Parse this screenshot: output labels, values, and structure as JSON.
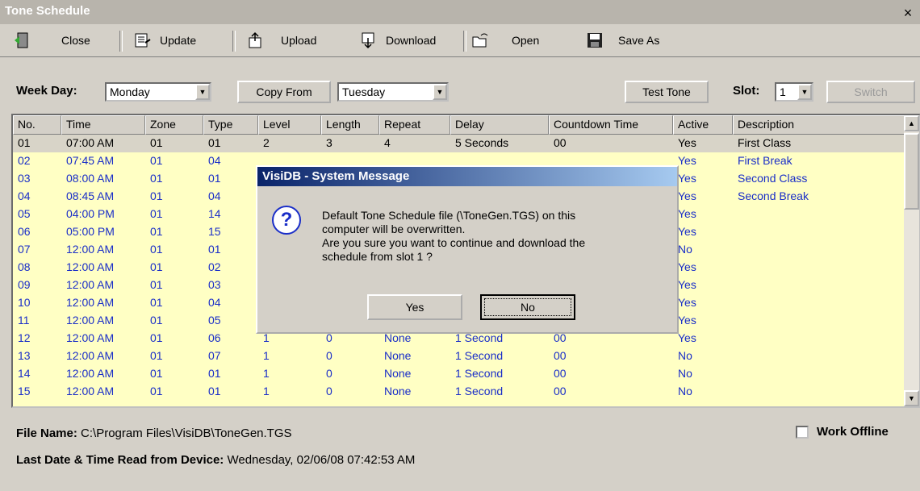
{
  "window": {
    "title": "Tone Schedule",
    "close_glyph": "×"
  },
  "toolbar": {
    "close": "Close",
    "update": "Update",
    "upload": "Upload",
    "download": "Download",
    "open": "Open",
    "save_as": "Save As"
  },
  "filters": {
    "week_day_label": "Week Day:",
    "week_day_value": "Monday",
    "copy_from_label": "Copy From",
    "copy_from_value": "Tuesday",
    "test_tone_label": "Test Tone",
    "slot_label": "Slot:",
    "slot_value": "1",
    "switch_label": "Switch"
  },
  "grid": {
    "headers": [
      "No.",
      "Time",
      "Zone",
      "Type",
      "Level",
      "Length",
      "Repeat",
      "Delay",
      "Countdown Time",
      "Active",
      "Description"
    ],
    "rows": [
      [
        "01",
        "07:00 AM",
        "01",
        "01",
        "2",
        "3",
        "4",
        "5 Seconds",
        "00",
        "Yes",
        "First Class"
      ],
      [
        "02",
        "07:45 AM",
        "01",
        "04",
        "",
        "",
        "",
        "",
        "",
        "Yes",
        "First Break"
      ],
      [
        "03",
        "08:00 AM",
        "01",
        "01",
        "",
        "",
        "",
        "",
        "",
        "Yes",
        "Second Class"
      ],
      [
        "04",
        "08:45 AM",
        "01",
        "04",
        "",
        "",
        "",
        "",
        "",
        "Yes",
        "Second Break"
      ],
      [
        "05",
        "04:00 PM",
        "01",
        "14",
        "",
        "",
        "",
        "",
        "",
        "Yes",
        ""
      ],
      [
        "06",
        "05:00 PM",
        "01",
        "15",
        "",
        "",
        "",
        "",
        "",
        "Yes",
        ""
      ],
      [
        "07",
        "12:00 AM",
        "01",
        "01",
        "",
        "",
        "",
        "",
        "",
        "No",
        ""
      ],
      [
        "08",
        "12:00 AM",
        "01",
        "02",
        "",
        "",
        "",
        "",
        "",
        "Yes",
        ""
      ],
      [
        "09",
        "12:00 AM",
        "01",
        "03",
        "",
        "",
        "",
        "",
        "",
        "Yes",
        ""
      ],
      [
        "10",
        "12:00 AM",
        "01",
        "04",
        "",
        "",
        "",
        "",
        "",
        "Yes",
        ""
      ],
      [
        "11",
        "12:00 AM",
        "01",
        "05",
        "",
        "",
        "",
        "",
        "",
        "Yes",
        ""
      ],
      [
        "12",
        "12:00 AM",
        "01",
        "06",
        "1",
        "0",
        "None",
        "1 Second",
        "00",
        "Yes",
        ""
      ],
      [
        "13",
        "12:00 AM",
        "01",
        "07",
        "1",
        "0",
        "None",
        "1 Second",
        "00",
        "No",
        ""
      ],
      [
        "14",
        "12:00 AM",
        "01",
        "01",
        "1",
        "0",
        "None",
        "1 Second",
        "00",
        "No",
        ""
      ],
      [
        "15",
        "12:00 AM",
        "01",
        "01",
        "1",
        "0",
        "None",
        "1 Second",
        "00",
        "No",
        ""
      ]
    ]
  },
  "dialog": {
    "title": "VisiDB - System Message",
    "line1": "Default Tone Schedule file (\\ToneGen.TGS) on this",
    "line2": "computer will be overwritten.",
    "line3": "Are you sure you want to continue and download the",
    "line4": "schedule from slot 1 ?",
    "yes": "Yes",
    "no": "No",
    "icon_glyph": "?"
  },
  "footer": {
    "file_label": "File Name:",
    "file_value": "C:\\Program Files\\VisiDB\\ToneGen.TGS",
    "last_label": "Last Date & Time Read from Device:",
    "last_value": "Wednesday, 02/06/08 07:42:53 AM",
    "offline_label": "Work Offline"
  },
  "colors": {
    "grid_bg": "#ffffc4",
    "link_blue": "#1a2ec8",
    "dialog_title": "#0a246a"
  }
}
